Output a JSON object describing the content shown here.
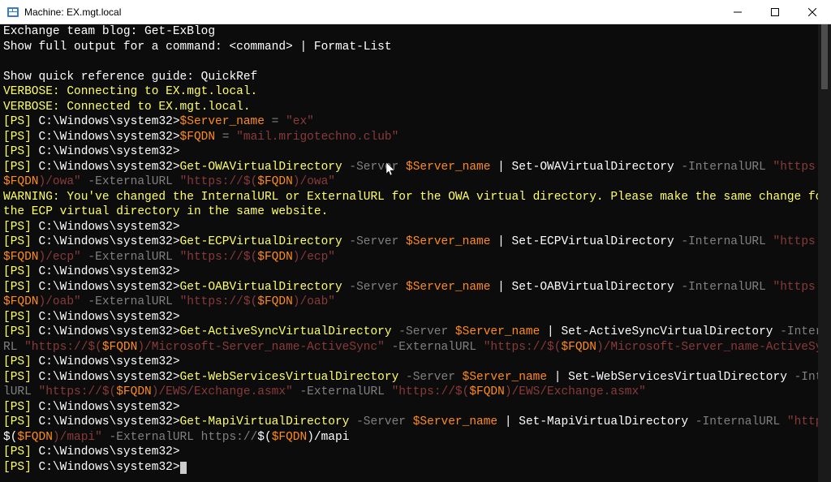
{
  "window": {
    "title": "Machine: EX.mgt.local"
  },
  "controls": {
    "minimize": "─",
    "maximize": "☐",
    "close": "✕"
  },
  "terminal": {
    "line1_a": "Exchange team blog: ",
    "line1_b": "Get-ExBlog",
    "line2_a": "Show full output for a command: <command> ",
    "line2_b": "| Format-List",
    "blank": "",
    "line3_a": "Show quick reference guide: ",
    "line3_b": "QuickRef",
    "line4": "VERBOSE: Connecting to EX.mgt.local.",
    "line5": "VERBOSE: Connected to EX.mgt.local.",
    "ps_prefix": "[PS] ",
    "ps_path": "C:\\Windows\\system32>",
    "var_server": "$Server_name",
    "eq": " = ",
    "str_ex": "\"ex\"",
    "var_fqdn": "$FQDN",
    "str_fqdn": "\"mail.mrigotechno.club\"",
    "cmd_owa_get": "Get-OWAVirtualDirectory",
    "param_server": " -Server ",
    "pipe_set_owa": " | Set-OWAVirtualDirectory",
    "param_intURL": " -InternalURL ",
    "url_https_pre": "\"https://$(",
    "url_owa_mid": ")/owa\"",
    "param_extURL": " -ExternalURL ",
    "warning_l1": "WARNING: You've changed the InternalURL or ExternalURL for the OWA virtual directory. Please make the same change for",
    "warning_l2": "the ECP virtual directory in the same website.",
    "cmd_ecp_get": "Get-ECPVirtualDirectory",
    "pipe_set_ecp": " | Set-ECPVirtualDirectory",
    "url_ecp_mid": ")/ecp\"",
    "cmd_oab_get": "Get-OABVirtualDirectory",
    "pipe_set_oab": " | Set-OABVirtualDirectory",
    "url_oab_mid": ")/oab\"",
    "cmd_as_get": "Get-ActiveSyncVirtualDirectory",
    "pipe_set_as": " | Set-ActiveSyncVirtualDirectory",
    "param_intU": " -InternalU",
    "rl": "RL ",
    "url_as_mid": ")/Microsoft-Server_name-ActiveSync\"",
    "cmd_ws_get": "Get-WebServicesVirtualDirectory",
    "pipe_set_ws": " | Set-WebServicesVirtualDirectory",
    "param_interna": " -Interna",
    "lURL": "lURL ",
    "url_ews_mid": ")/EWS/Exchange.asmx\"",
    "cmd_mapi_get": "Get-MapiVirtualDirectory",
    "pipe_set_mapi": " | Set-MapiVirtualDirectory",
    "url_https_pre2": "\"https://",
    "dollar_open": "$(",
    "url_mapi_mid": ")/mapi\"",
    "ext_plain_a": " -ExternalURL https://",
    "ext_mapi_end": ")/mapi"
  }
}
